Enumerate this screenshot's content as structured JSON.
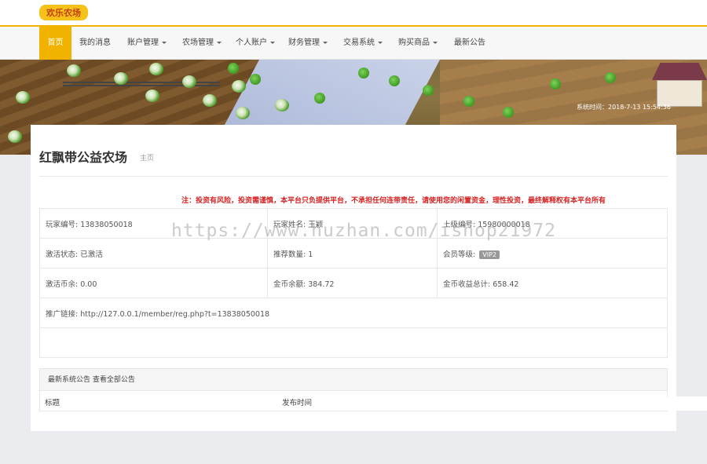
{
  "colors": {
    "accent": "#f2b300",
    "notice": "#d62222"
  },
  "logo": {
    "text": "欢乐农场"
  },
  "nav": {
    "items": [
      {
        "label": "首页",
        "active": true,
        "dropdown": false
      },
      {
        "label": "我的消息",
        "dropdown": false
      },
      {
        "label": "账户管理",
        "dropdown": true
      },
      {
        "label": "农场管理",
        "dropdown": true
      },
      {
        "label": "个人账户",
        "dropdown": true
      },
      {
        "label": "财务管理",
        "dropdown": true
      },
      {
        "label": "交易系统",
        "dropdown": true
      },
      {
        "label": "购买商品",
        "dropdown": true
      },
      {
        "label": "最新公告",
        "dropdown": false
      }
    ]
  },
  "banner": {
    "system_time": "系统时间：2018-7-13 15:54:36"
  },
  "page": {
    "title": "红飘带公益农场",
    "subtitle": "主页",
    "notice": "注：投资有风险，投资需谨慎，本平台只负提供平台，不承担任何连带责任，请使用您的闲置资金，理性投资，最终解释权有本平台所有"
  },
  "info": {
    "player_id": "玩家编号: 13838050018",
    "player_name": "玩家姓名: 王颖",
    "superior_id": "上级编号: 15980000018",
    "activation_status": "激活状态: 已激活",
    "referral_count": "推荐数量: 1",
    "member_level_label": "会员等级:",
    "member_level": "VIP2",
    "activation_balance": "激活币余: 0.00",
    "gold_balance": "金币余额: 384.72",
    "gold_income_total": "金币收益总计: 658.42",
    "promo_link": "推广链接: http://127.0.0.1/member/reg.php?t=13838050018"
  },
  "announcements": {
    "header": "最新系统公告 查看全部公告",
    "col_title": "标题",
    "col_time": "发布时间"
  },
  "watermark": "https://www.huzhan.com/ishop21972"
}
